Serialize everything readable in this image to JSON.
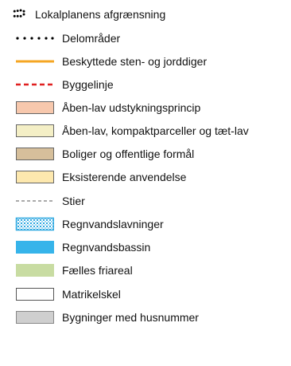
{
  "legend": {
    "items": [
      {
        "label": "Lokalplanens afgrænsning",
        "symbol": "big-dots-icon"
      },
      {
        "label": "Delområder",
        "symbol": "small-dots-icon"
      },
      {
        "label": "Beskyttede sten- og jorddiger",
        "symbol": "orange-line-icon",
        "color": "#f5a623"
      },
      {
        "label": "Byggelinje",
        "symbol": "red-dashed-line-icon",
        "color": "#e02020"
      },
      {
        "label": "Åben-lav udstykningsprincip",
        "symbol": "swatch-icon",
        "color": "#f7c8ad"
      },
      {
        "label": "Åben-lav, kompaktparceller og tæt-lav",
        "symbol": "swatch-icon",
        "color": "#f4efc6"
      },
      {
        "label": "Boliger og offentlige formål",
        "symbol": "swatch-icon",
        "color": "#d6bf9b"
      },
      {
        "label": "Eksisterende anvendelse",
        "symbol": "swatch-icon",
        "color": "#fde8ae"
      },
      {
        "label": "Stier",
        "symbol": "grey-dashed-line-icon",
        "color": "#777777"
      },
      {
        "label": "Regnvandslavninger",
        "symbol": "grid-swatch-icon",
        "color": "#2ea8e0"
      },
      {
        "label": "Regnvandsbassin",
        "symbol": "swatch-icon",
        "color": "#36b4ea"
      },
      {
        "label": "Fælles friareal",
        "symbol": "swatch-icon",
        "color": "#c8dca2"
      },
      {
        "label": "Matrikelskel",
        "symbol": "swatch-icon",
        "color": "#ffffff"
      },
      {
        "label": "Bygninger med husnummer",
        "symbol": "swatch-icon",
        "color": "#cfcfcf"
      }
    ]
  }
}
